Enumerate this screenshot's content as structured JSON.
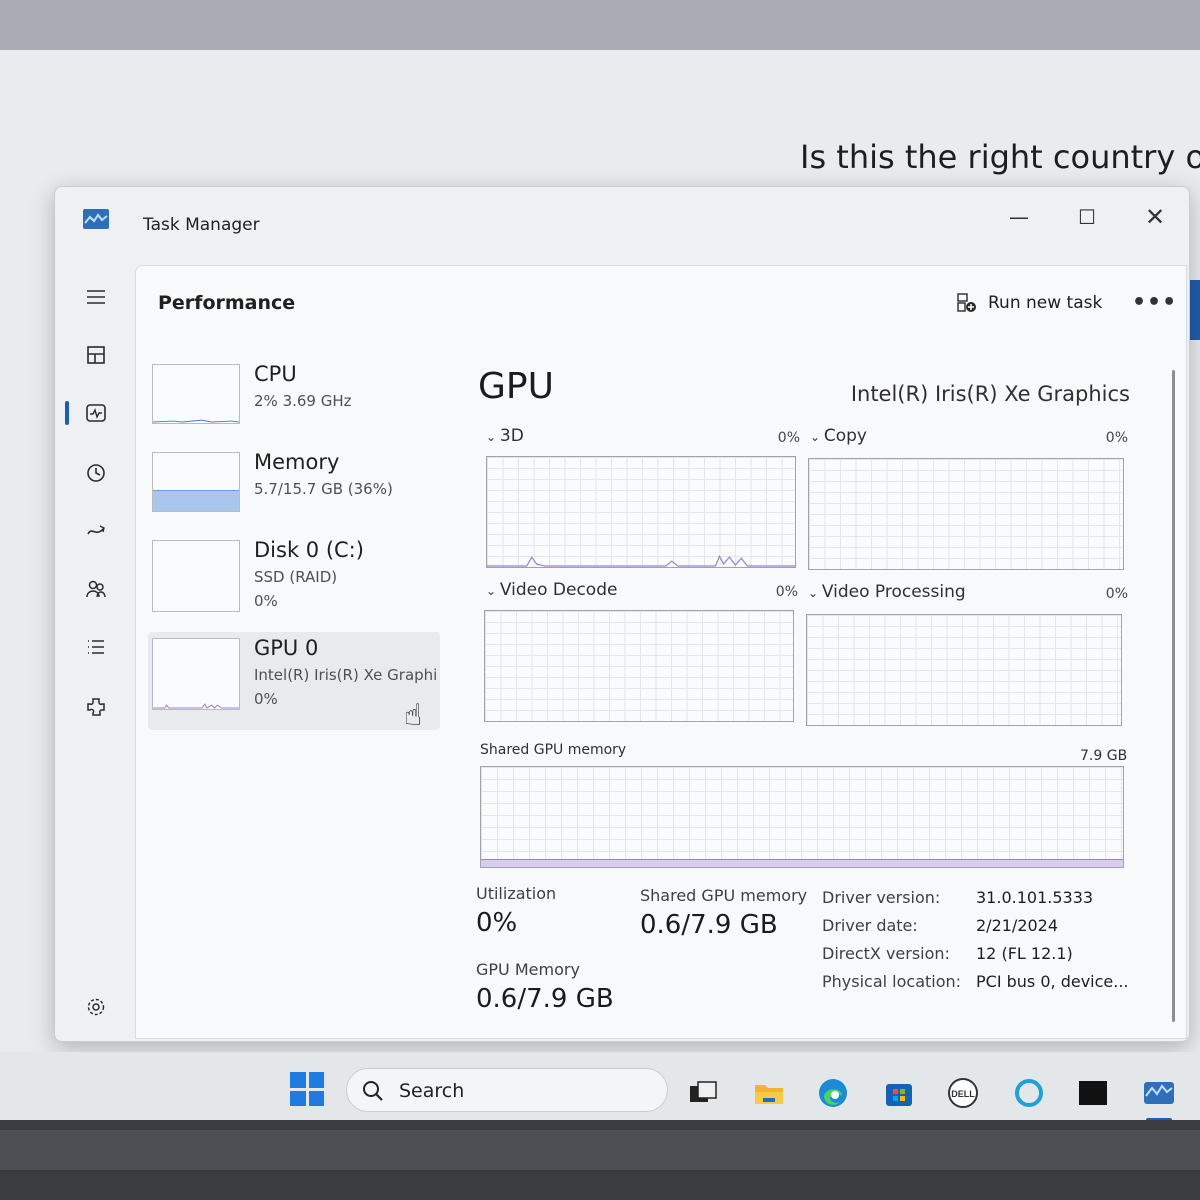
{
  "background": {
    "heading": "Is this the right country o"
  },
  "window": {
    "title": "Task Manager",
    "controls": {
      "minimize": "—",
      "maximize": "☐",
      "close": "✕"
    }
  },
  "nav": [
    {
      "name": "hamburger-menu-icon"
    },
    {
      "name": "processes-icon"
    },
    {
      "name": "performance-icon",
      "selected": true
    },
    {
      "name": "app-history-icon"
    },
    {
      "name": "startup-apps-icon"
    },
    {
      "name": "users-icon"
    },
    {
      "name": "details-icon"
    },
    {
      "name": "services-icon"
    },
    {
      "name": "settings-icon"
    }
  ],
  "page": {
    "title": "Performance",
    "run_task": "Run new task",
    "more": "•••"
  },
  "devices": [
    {
      "name": "CPU",
      "sub": "2% 3.69 GHz",
      "sub2": ""
    },
    {
      "name": "Memory",
      "sub": "5.7/15.7 GB (36%)",
      "sub2": ""
    },
    {
      "name": "Disk 0 (C:)",
      "sub": "SSD (RAID)",
      "sub2": "0%"
    },
    {
      "name": "GPU 0",
      "sub": "Intel(R) Iris(R) Xe Graphi",
      "sub2": "0%",
      "selected": true
    }
  ],
  "detail": {
    "title": "GPU",
    "model": "Intel(R) Iris(R) Xe Graphics",
    "engines": [
      {
        "label": "3D",
        "value": "0%"
      },
      {
        "label": "Copy",
        "value": "0%"
      },
      {
        "label": "Video Decode",
        "value": "0%"
      },
      {
        "label": "Video Processing",
        "value": "0%"
      }
    ],
    "shared_memory_graph": {
      "label": "Shared GPU memory",
      "max": "7.9 GB"
    },
    "stats": {
      "utilization_label": "Utilization",
      "utilization_value": "0%",
      "shared_label": "Shared GPU memory",
      "shared_value": "0.6/7.9 GB",
      "gpu_mem_label": "GPU Memory",
      "gpu_mem_value": "0.6/7.9 GB"
    },
    "properties": [
      {
        "key": "Driver version:",
        "value": "31.0.101.5333"
      },
      {
        "key": "Driver date:",
        "value": "2/21/2024"
      },
      {
        "key": "DirectX version:",
        "value": "12 (FL 12.1)"
      },
      {
        "key": "Physical location:",
        "value": "PCI bus 0, device..."
      }
    ]
  },
  "taskbar": {
    "search_placeholder": "Search",
    "apps": [
      "task-view-icon",
      "file-explorer-icon",
      "edge-icon",
      "store-icon",
      "dell-icon",
      "cortana-icon",
      "terminal-icon",
      "task-manager-icon"
    ]
  },
  "colors": {
    "accent": "#1a5fb4",
    "graph_line": "#9b7fd4",
    "memory_fill": "#a9c6ec"
  }
}
